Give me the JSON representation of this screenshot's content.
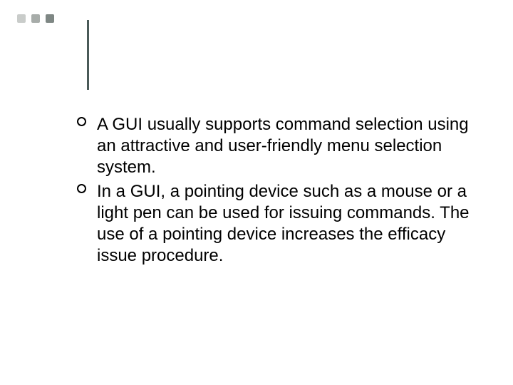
{
  "decor": {
    "dot_colors": [
      "#c9ccca",
      "#a7aca9",
      "#7e8784"
    ],
    "vline_color": "#4a5a58"
  },
  "bullets": [
    {
      "text": "A GUI usually supports command selection using an attractive and user-friendly menu selection system."
    },
    {
      "text": "In a GUI, a pointing device such as a mouse or a light pen can be used for issuing commands. The use of a pointing device increases the efficacy issue procedure."
    }
  ]
}
